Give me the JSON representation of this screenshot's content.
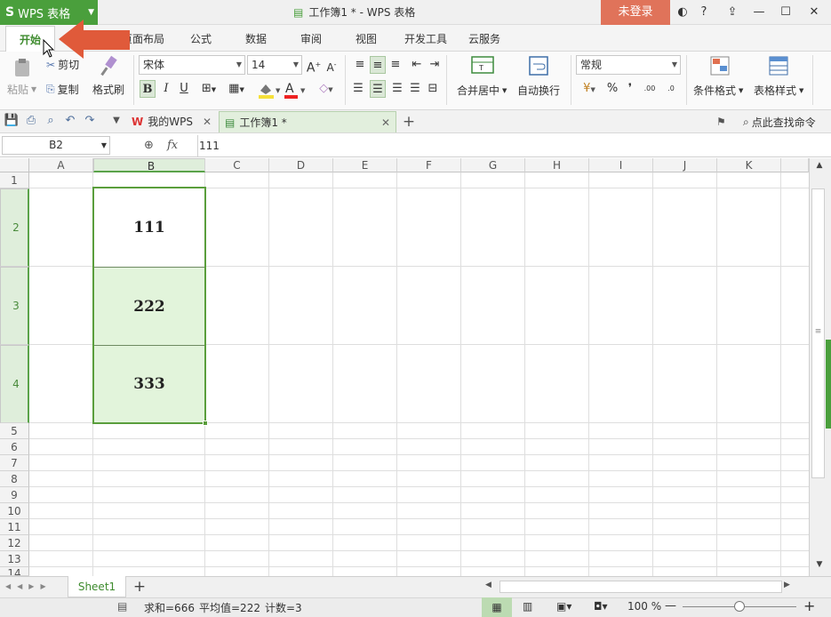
{
  "titlebar": {
    "app_name": "WPS 表格",
    "doc_title": "工作簿1 * - WPS 表格",
    "login_label": "未登录",
    "help_label": "?"
  },
  "menu": {
    "tabs": [
      "开始",
      "页面布局",
      "公式",
      "数据",
      "审阅",
      "视图",
      "开发工具",
      "云服务"
    ]
  },
  "ribbon": {
    "paste_label": "粘贴",
    "cut_label": "剪切",
    "copy_label": "复制",
    "format_painter_label": "格式刷",
    "font_name": "宋体",
    "font_size": "14",
    "bold": "B",
    "italic": "I",
    "underline": "U",
    "merge_label": "合并居中",
    "wrap_label": "自动换行",
    "number_format": "常规",
    "percent": "%",
    "comma": "❜",
    "conditional_label": "条件格式",
    "table_style_label": "表格样式"
  },
  "tabs_bar": {
    "wps_tab": "我的WPS",
    "book_tab": "工作簿1 *",
    "search_label": "点此查找命令"
  },
  "formula_bar": {
    "name_box": "B2",
    "fx": "fx",
    "value": "111"
  },
  "grid": {
    "columns": [
      "A",
      "B",
      "C",
      "D",
      "E",
      "F",
      "G",
      "H",
      "I",
      "J",
      "K"
    ],
    "rows": [
      "1",
      "2",
      "3",
      "4",
      "5",
      "6",
      "7",
      "8",
      "9",
      "10",
      "11",
      "12",
      "13",
      "14"
    ],
    "cells": {
      "B2": "111",
      "B3": "222",
      "B4": "333"
    }
  },
  "sheets": {
    "active": "Sheet1",
    "add": "+"
  },
  "status": {
    "sum": "求和=666",
    "avg": "平均值=222",
    "count": "计数=3",
    "zoom": "100 %"
  },
  "colors": {
    "accent_green": "#4a9f3c",
    "login_orange": "#e0735a",
    "selection_fill": "#e2f4db",
    "selection_border": "#5a9e3c",
    "arrow": "#e05a3a"
  }
}
